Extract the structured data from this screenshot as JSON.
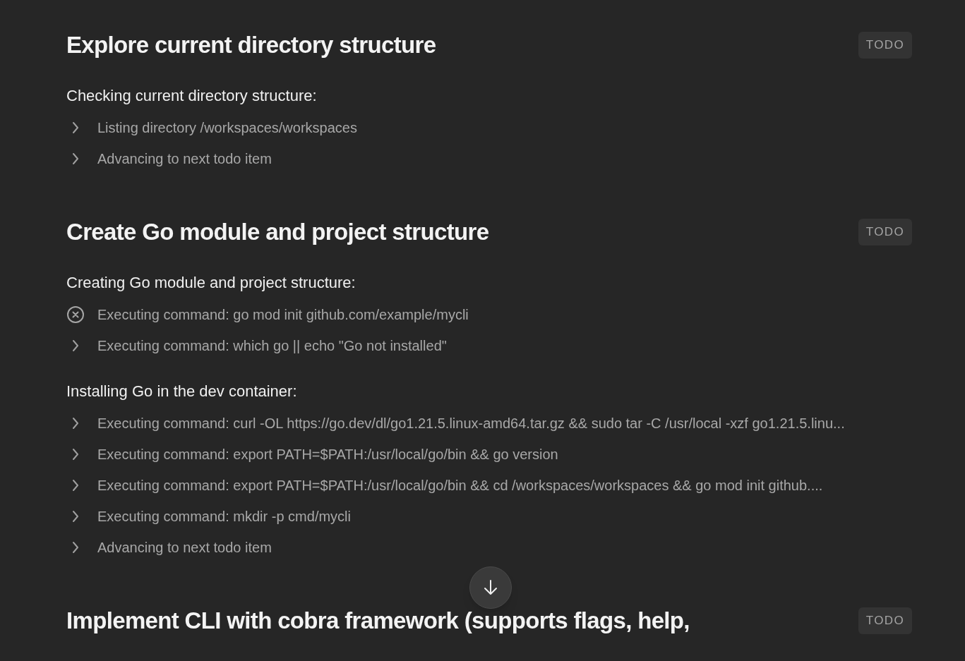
{
  "sections": [
    {
      "title": "Explore current directory structure",
      "badge": "TODO",
      "groups": [
        {
          "heading": "Checking current directory structure:",
          "rows": [
            {
              "kind": "collapsed",
              "text": "Listing directory /workspaces/workspaces"
            },
            {
              "kind": "collapsed",
              "text": "Advancing to next todo item"
            }
          ]
        }
      ]
    },
    {
      "title": "Create Go module and project structure",
      "badge": "TODO",
      "groups": [
        {
          "heading": "Creating Go module and project structure:",
          "rows": [
            {
              "kind": "failed",
              "text": "Executing command: go mod init github.com/example/mycli"
            },
            {
              "kind": "collapsed",
              "text": "Executing command: which go || echo \"Go not installed\""
            }
          ]
        },
        {
          "heading": "Installing Go in the dev container:",
          "rows": [
            {
              "kind": "collapsed",
              "text": "Executing command: curl -OL https://go.dev/dl/go1.21.5.linux-amd64.tar.gz && sudo tar -C /usr/local -xzf go1.21.5.linu..."
            },
            {
              "kind": "collapsed",
              "text": "Executing command: export PATH=$PATH:/usr/local/go/bin && go version"
            },
            {
              "kind": "collapsed",
              "text": "Executing command: export PATH=$PATH:/usr/local/go/bin && cd /workspaces/workspaces && go mod init github...."
            },
            {
              "kind": "collapsed",
              "text": "Executing command: mkdir -p cmd/mycli"
            },
            {
              "kind": "collapsed",
              "text": "Advancing to next todo item"
            }
          ]
        }
      ]
    },
    {
      "title": "Implement CLI with cobra framework (supports flags, help,",
      "badge": "TODO"
    }
  ]
}
